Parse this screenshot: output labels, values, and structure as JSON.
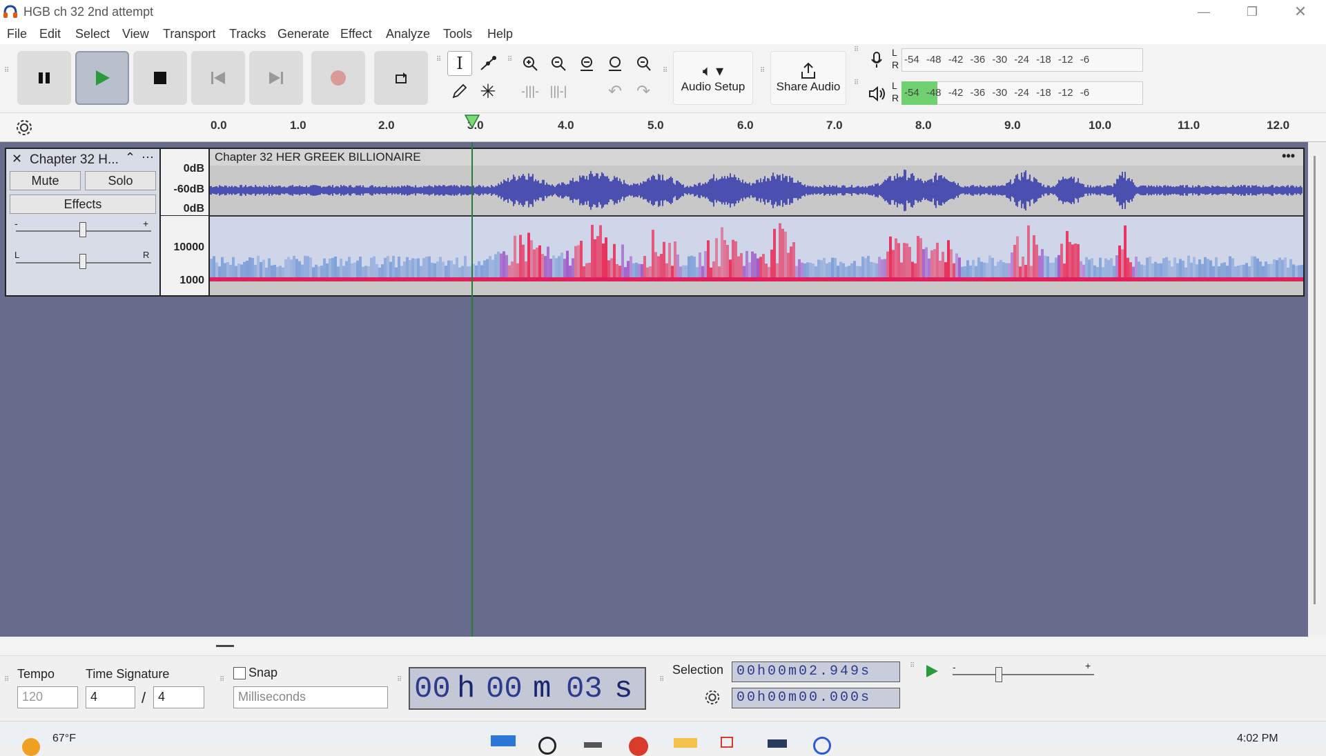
{
  "window": {
    "title": "HGB ch 32 2nd attempt"
  },
  "menu": [
    "File",
    "Edit",
    "Select",
    "View",
    "Transport",
    "Tracks",
    "Generate",
    "Effect",
    "Analyze",
    "Tools",
    "Help"
  ],
  "toolbar": {
    "audio_setup": "Audio Setup",
    "share_audio": "Share Audio",
    "rec_meter": {
      "L": "L",
      "R": "R",
      "ticks": "-54 -48 -42 -36 -30 -24 -18 -12 -6"
    },
    "play_meter": {
      "L": "L",
      "R": "R",
      "ticks": "-54 -48 -42 -36 -30 -24 -18 -12 -6"
    }
  },
  "ruler": {
    "ticks": [
      "0.0",
      "1.0",
      "2.0",
      "3.0",
      "4.0",
      "5.0",
      "6.0",
      "7.0",
      "8.0",
      "9.0",
      "10.0",
      "11.0",
      "12.0"
    ]
  },
  "track": {
    "name": "Chapter 32 H...",
    "mute": "Mute",
    "solo": "Solo",
    "effects": "Effects",
    "gain_minus": "-",
    "gain_plus": "+",
    "pan_left": "L",
    "pan_right": "R",
    "db_labels": [
      "0dB",
      "-60dB",
      "0dB"
    ],
    "freq_labels": [
      "10000",
      "1000"
    ],
    "clip_title": "Chapter 32 HER GREEK BILLIONAIRE",
    "clip_menu": "•••"
  },
  "bottom": {
    "tempo_label": "Tempo",
    "tempo_value": "120",
    "time_sig_label": "Time Signature",
    "time_sig_num": "4",
    "time_sig_slash": "/",
    "time_sig_den": "4",
    "snap_label": "Snap",
    "snap_unit": "Milliseconds",
    "time_display": {
      "h": "00",
      "h_unit": "h",
      "m": "00",
      "m_unit": "m",
      "s": "03",
      "s_unit": "s"
    },
    "selection_label": "Selection",
    "selection_start": "00h00m02.949s",
    "selection_end": "00h00m00.000s",
    "speed_minus": "-",
    "speed_plus": "+"
  },
  "taskbar": {
    "weather": "67°F",
    "clock": "4:02 PM"
  },
  "colors": {
    "track_bg": "#686c8c",
    "waveform": "#4a4fb0",
    "playhead": "#2a7a3a"
  }
}
